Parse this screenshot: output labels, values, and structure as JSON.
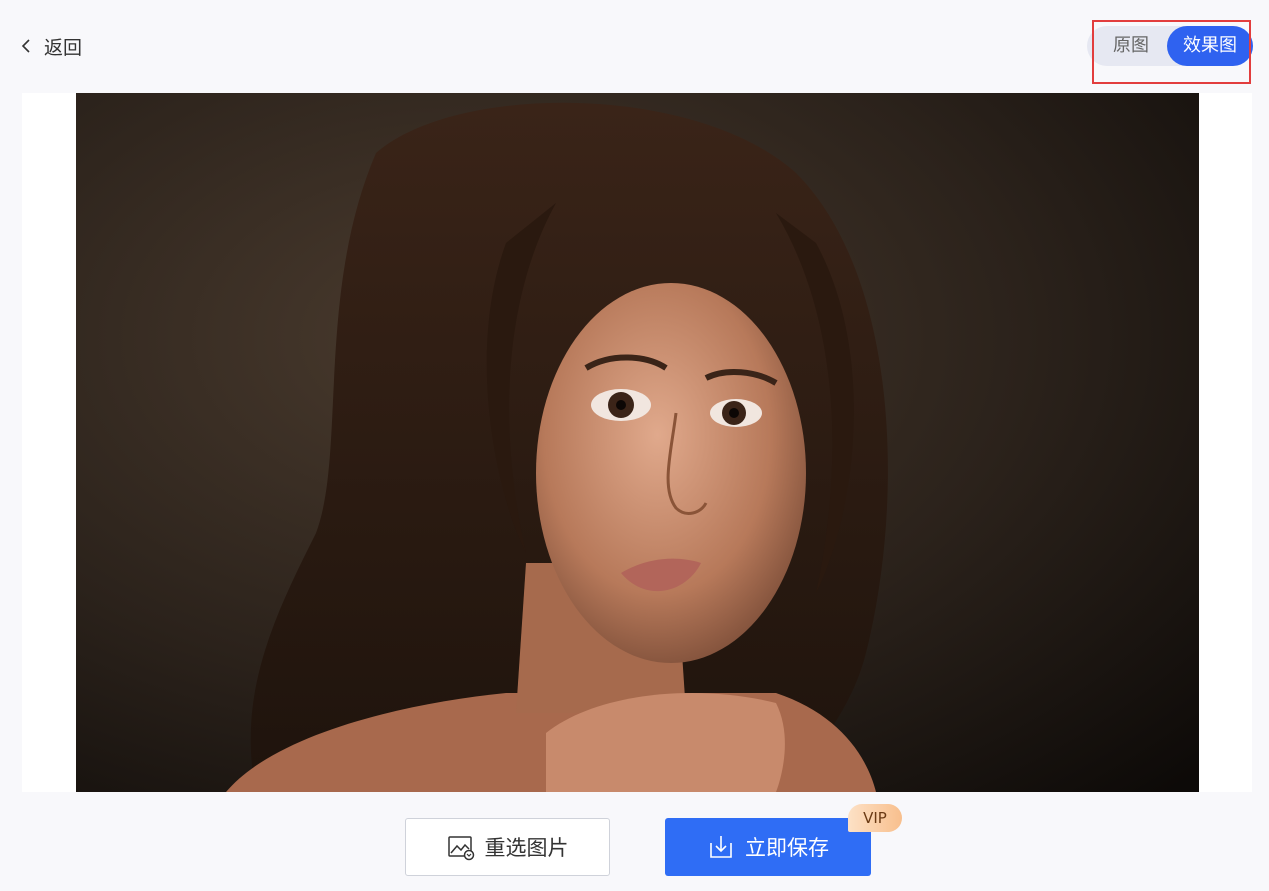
{
  "header": {
    "back_label": "返回",
    "back_icon": "chevron-left-icon"
  },
  "view_toggle": {
    "options": [
      "原图",
      "效果图"
    ],
    "selected": "效果图",
    "accent_color": "#2f62f0",
    "highlight_color": "#e23d3d"
  },
  "preview": {
    "image_subject": "portrait photo of a young woman with long brown hair, hands clasped under chin, dark background"
  },
  "actions": {
    "reselect_label": "重选图片",
    "reselect_icon": "image-replace-icon",
    "save_label": "立即保存",
    "save_icon": "download-icon",
    "save_badge": "VIP",
    "save_color": "#2f6df5"
  }
}
